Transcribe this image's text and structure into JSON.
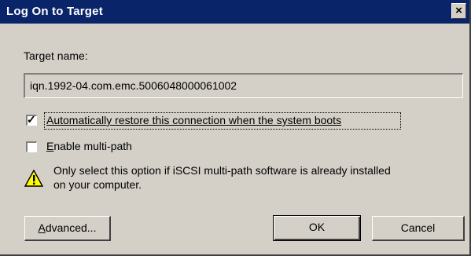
{
  "window": {
    "title": "Log On to Target",
    "close_glyph": "×"
  },
  "target": {
    "label": "Target name:",
    "value": "iqn.1992-04.com.emc.5006048000061002"
  },
  "options": {
    "auto_restore": {
      "label": "Automatically restore this connection when the system boots",
      "checked": true
    },
    "multipath": {
      "label_accel": "E",
      "label_rest": "nable multi-path",
      "checked": false
    }
  },
  "warning": {
    "icon": "warning-icon",
    "line1": "Only select this option if iSCSI multi-path software is already installed",
    "line2": "on your computer."
  },
  "buttons": {
    "advanced_accel": "A",
    "advanced_rest": "dvanced...",
    "ok": "OK",
    "cancel": "Cancel"
  },
  "colors": {
    "titlebar": "#0a246a",
    "dialog_bg": "#d4d0c8",
    "warning_yellow": "#ffff00"
  }
}
